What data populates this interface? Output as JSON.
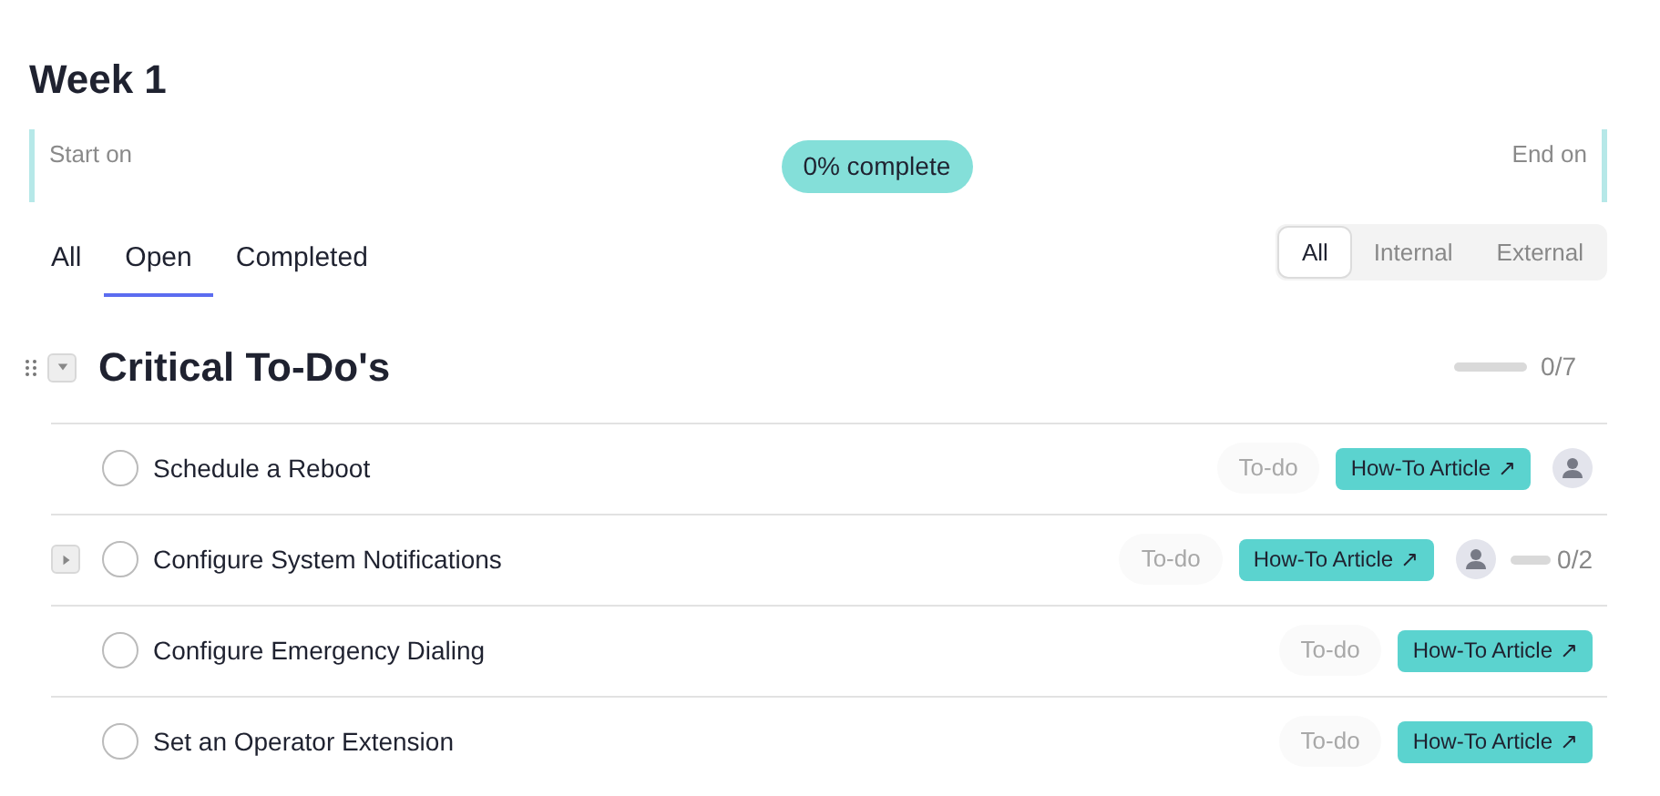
{
  "title": "Week 1",
  "timeline": {
    "start_label": "Start on",
    "end_label": "End on",
    "progress": "0% complete"
  },
  "tabs": [
    {
      "label": "All",
      "selected": false
    },
    {
      "label": "Open",
      "selected": true
    },
    {
      "label": "Completed",
      "selected": false
    }
  ],
  "filter": [
    {
      "label": "All",
      "selected": true
    },
    {
      "label": "Internal",
      "selected": false
    },
    {
      "label": "External",
      "selected": false
    }
  ],
  "section": {
    "title": "Critical To-Do's",
    "expanded": true,
    "count": "0/7",
    "tasks": [
      {
        "name": "Schedule a Reboot",
        "checked": false,
        "status": "To-do",
        "link": "How-To Article",
        "link_icon": "↗",
        "assigned": true
      },
      {
        "name": "Configure System Notifications",
        "checked": false,
        "expanded": false,
        "status": "To-do",
        "link": "How-To Article",
        "link_icon": "↗",
        "assigned": true,
        "subtask_count": "0/2"
      },
      {
        "name": "Configure Emergency Dialing",
        "checked": false,
        "status": "To-do",
        "link": "How-To Article",
        "link_icon": "↗",
        "assigned": false
      },
      {
        "name": "Set an Operator Extension",
        "checked": false,
        "status": "To-do",
        "link": "How-To Article",
        "link_icon": "↗",
        "assigned": false
      }
    ]
  }
}
